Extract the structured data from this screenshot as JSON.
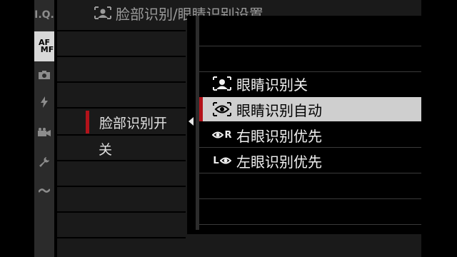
{
  "rail": {
    "items": [
      {
        "name": "iq-icon",
        "label": "I.Q."
      },
      {
        "name": "af-mf-icon",
        "label_top": "AF",
        "label_bottom": "MF"
      },
      {
        "name": "camera-icon"
      },
      {
        "name": "flash-icon"
      },
      {
        "name": "movie-icon"
      },
      {
        "name": "wrench-icon"
      },
      {
        "name": "wave-icon"
      }
    ]
  },
  "background_menu": {
    "title": "脸部识别/眼睛识别设置",
    "selected_value": "脸部识别开",
    "next_value": "关"
  },
  "submenu": {
    "options": [
      {
        "label": "眼睛识别关",
        "icon": "face-eye-off-icon",
        "selected": false
      },
      {
        "label": "眼睛识别自动",
        "icon": "eye-auto-icon",
        "selected": true
      },
      {
        "label": "右眼识别优先",
        "icon": "right-eye-priority-icon",
        "icon_text": "R",
        "selected": false
      },
      {
        "label": "左眼识别优先",
        "icon": "left-eye-priority-icon",
        "icon_text": "L",
        "selected": false
      }
    ]
  },
  "colors": {
    "accent_red": "#b3121a",
    "highlight": "#cfcfcf",
    "panel": "#1a1a1a",
    "rail": "#2b2b2b"
  }
}
